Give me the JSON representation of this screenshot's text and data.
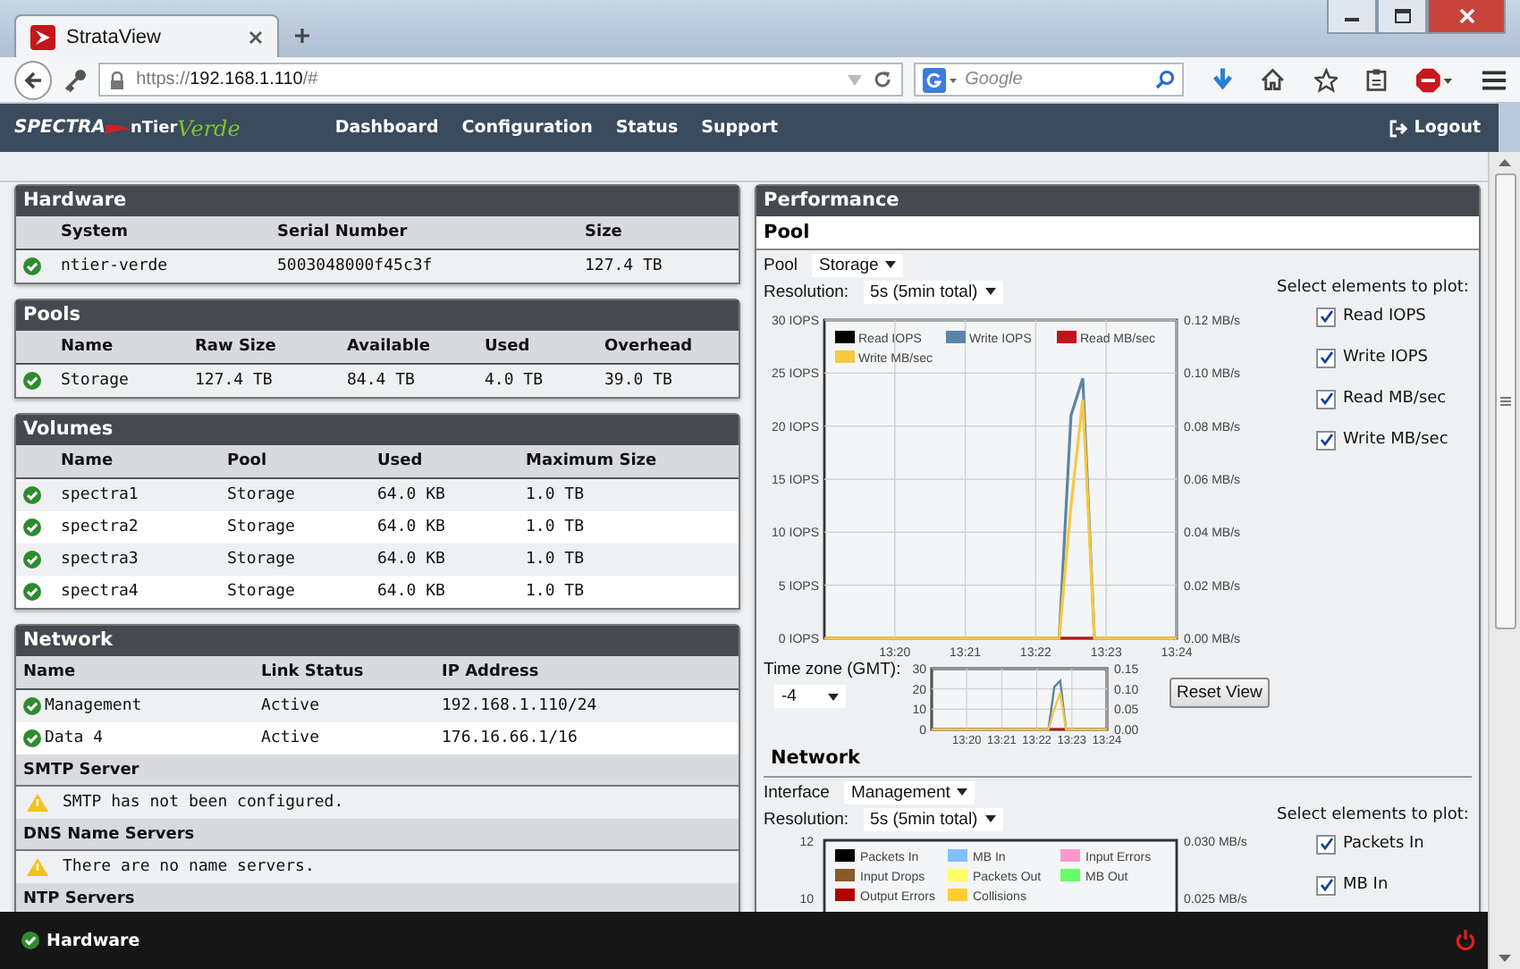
{
  "browser": {
    "tab_title": "StrataView",
    "url": {
      "scheme": "https://",
      "host": "192.168.1.110",
      "path": "/#"
    },
    "search_placeholder": "Google"
  },
  "app_nav": {
    "logo": {
      "brand": "SPECTRA",
      "product": "nTier",
      "product_suffix": "Verde"
    },
    "links": [
      {
        "label": "Dashboard"
      },
      {
        "label": "Configuration"
      },
      {
        "label": "Status"
      },
      {
        "label": "Support"
      }
    ],
    "logout": "Logout"
  },
  "panels": [
    {
      "title": "Hardware",
      "columns": [
        "System",
        "Serial Number",
        "Size"
      ],
      "rows": [
        {
          "kind": "ok",
          "cells": [
            "ntier-verde",
            "5003048000f45c3f",
            "127.4 TB"
          ]
        }
      ]
    },
    {
      "title": "Pools",
      "columns": [
        "Name",
        "Raw Size",
        "Available",
        "Used",
        "Overhead"
      ],
      "rows": [
        {
          "kind": "ok",
          "cells": [
            "Storage",
            "127.4 TB",
            "84.4 TB",
            "4.0 TB",
            "39.0 TB"
          ]
        }
      ]
    },
    {
      "title": "Volumes",
      "columns": [
        "Name",
        "Pool",
        "Used",
        "Maximum Size"
      ],
      "rows": [
        {
          "kind": "ok",
          "cells": [
            "spectra1",
            "Storage",
            "64.0 KB",
            "1.0 TB"
          ]
        },
        {
          "kind": "ok",
          "cells": [
            "spectra2",
            "Storage",
            "64.0 KB",
            "1.0 TB"
          ]
        },
        {
          "kind": "ok",
          "cells": [
            "spectra3",
            "Storage",
            "64.0 KB",
            "1.0 TB"
          ]
        },
        {
          "kind": "ok",
          "cells": [
            "spectra4",
            "Storage",
            "64.0 KB",
            "1.0 TB"
          ]
        }
      ]
    }
  ],
  "network": {
    "title": "Network",
    "columns": [
      "Name",
      "Link Status",
      "IP Address"
    ],
    "rows": [
      {
        "kind": "ok",
        "cells": [
          "Management",
          "Active",
          "192.168.1.110/24"
        ]
      },
      {
        "kind": "ok",
        "cells": [
          "Data 4",
          "Active",
          "176.16.66.1/16"
        ]
      }
    ],
    "sections": [
      {
        "title": "SMTP Server",
        "messages": [
          {
            "kind": "warning",
            "text": "SMTP has not been configured."
          }
        ]
      },
      {
        "title": "DNS Name Servers",
        "messages": [
          {
            "kind": "warning",
            "text": "There are no name servers."
          }
        ]
      },
      {
        "title": "NTP Servers"
      }
    ]
  },
  "performance": {
    "title": "Performance",
    "pool": {
      "title": "Pool",
      "pool_label": "Pool",
      "pool_value": "Storage",
      "resolution_label": "Resolution:",
      "resolution_value": "5s (5min total)",
      "plot_label": "Select elements to plot:",
      "plot_options": [
        {
          "label": "Read IOPS",
          "checked": true
        },
        {
          "label": "Write IOPS",
          "checked": true
        },
        {
          "label": "Read MB/sec",
          "checked": true
        },
        {
          "label": "Write MB/sec",
          "checked": true
        }
      ],
      "chart_data": {
        "type": "line",
        "grid": true,
        "legend": true,
        "categories": [
          null,
          null,
          null,
          null,
          null,
          null,
          "13:20",
          null,
          null,
          null,
          null,
          null,
          "13:21",
          null,
          null,
          null,
          null,
          null,
          "13:22",
          null,
          null,
          null,
          null,
          null,
          "13:23",
          null,
          null,
          null,
          null,
          null,
          "13:24"
        ],
        "ylim": [
          0,
          30
        ],
        "y2lim": [
          0,
          0.12
        ],
        "yticks": [
          {
            "value": 0,
            "label": "0 IOPS"
          },
          {
            "value": 5,
            "label": "5 IOPS"
          },
          {
            "value": 10,
            "label": "10 IOPS"
          },
          {
            "value": 15,
            "label": "15 IOPS"
          },
          {
            "value": 20,
            "label": "20 IOPS"
          },
          {
            "value": 25,
            "label": "25 IOPS"
          },
          {
            "value": 30,
            "label": "30 IOPS"
          }
        ],
        "y2ticks": [
          {
            "value": 0,
            "label": "0.00 MB/s"
          },
          {
            "value": 0.02,
            "label": "0.02 MB/s"
          },
          {
            "value": 0.04,
            "label": "0.04 MB/s"
          },
          {
            "value": 0.06,
            "label": "0.06 MB/s"
          },
          {
            "value": 0.08,
            "label": "0.08 MB/s"
          },
          {
            "value": 0.1,
            "label": "0.10 MB/s"
          },
          {
            "value": 0.12,
            "label": "0.12 MB/s"
          }
        ],
        "series": [
          {
            "name": "Read IOPS",
            "color": "#000000",
            "values": [
              null,
              null,
              null,
              null,
              null,
              null,
              null,
              null,
              null,
              null,
              null,
              null,
              null,
              null,
              null,
              null,
              null,
              null,
              null,
              null,
              null,
              null,
              null,
              null,
              null,
              null,
              null,
              null,
              null,
              null,
              null
            ]
          },
          {
            "name": "Write IOPS",
            "color": "#5b84a8",
            "values": [
              null,
              null,
              null,
              null,
              null,
              null,
              null,
              null,
              null,
              null,
              null,
              null,
              null,
              null,
              null,
              null,
              null,
              null,
              null,
              null,
              0,
              21,
              24.5,
              0,
              null,
              null,
              null,
              null,
              null,
              null,
              null
            ]
          },
          {
            "name": "Read MB/sec",
            "color": "#c0141a",
            "axis": "y2",
            "values": [
              null,
              null,
              null,
              null,
              null,
              null,
              null,
              null,
              null,
              null,
              null,
              null,
              null,
              null,
              null,
              null,
              null,
              null,
              null,
              null,
              0,
              0,
              0,
              0,
              null,
              null,
              null,
              null,
              null,
              null,
              null
            ]
          },
          {
            "name": "Write MB/sec",
            "color": "#f7c842",
            "axis": "y2",
            "values": [
              0,
              0,
              0,
              0,
              0,
              0,
              0,
              0,
              0,
              0,
              0,
              0,
              0,
              0,
              0,
              0,
              0,
              0,
              0,
              0,
              0,
              0.05,
              0.09,
              0,
              0,
              0,
              0,
              0,
              0,
              0,
              0
            ]
          }
        ]
      },
      "timezone_label": "Time zone (GMT):",
      "timezone_value": "-4",
      "overview": {
        "chart_data": {
          "type": "line",
          "grid": true,
          "categories": [
            null,
            null,
            null,
            null,
            null,
            null,
            "13:20",
            null,
            null,
            null,
            null,
            null,
            "13:21",
            null,
            null,
            null,
            null,
            null,
            "13:22",
            null,
            null,
            null,
            null,
            null,
            "13:23",
            null,
            null,
            null,
            null,
            null,
            "13:24"
          ],
          "ylim": [
            0,
            30
          ],
          "y2lim": [
            0,
            0.15
          ],
          "yticks": [
            0,
            10,
            20,
            30
          ],
          "y2ticks": [
            {
              "value": 0,
              "label": "0.00"
            },
            {
              "value": 0.05,
              "label": "0.05"
            },
            {
              "value": 0.1,
              "label": "0.10"
            },
            {
              "value": 0.15,
              "label": "0.15"
            }
          ],
          "series": [
            {
              "color": "#5b84a8",
              "values": [
                null,
                null,
                null,
                null,
                null,
                null,
                null,
                null,
                null,
                null,
                null,
                null,
                null,
                null,
                null,
                null,
                null,
                null,
                null,
                null,
                0,
                21,
                24,
                0,
                null,
                null,
                null,
                null,
                null,
                null,
                null
              ]
            },
            {
              "color": "#c0141a",
              "axis": "y2",
              "values": [
                null,
                null,
                null,
                null,
                null,
                null,
                null,
                null,
                null,
                null,
                null,
                null,
                null,
                null,
                null,
                null,
                null,
                null,
                null,
                null,
                0,
                0,
                0,
                0,
                null,
                null,
                null,
                null,
                null,
                null,
                null
              ]
            },
            {
              "color": "#f7c842",
              "axis": "y2",
              "values": [
                0,
                0,
                0,
                0,
                0,
                0,
                0,
                0,
                0,
                0,
                0,
                0,
                0,
                0,
                0,
                0,
                0,
                0,
                0,
                0,
                0,
                0.05,
                0.09,
                0,
                0,
                0,
                0,
                0,
                0,
                0,
                0
              ]
            }
          ]
        }
      },
      "reset_button": "Reset View"
    },
    "network": {
      "title": "Network",
      "interface_label": "Interface",
      "interface_value": "Management",
      "resolution_label": "Resolution:",
      "resolution_value": "5s (5min total)",
      "plot_label": "Select elements to plot:",
      "plot_options": [
        {
          "label": "Packets In",
          "checked": true
        },
        {
          "label": "MB In",
          "checked": true
        }
      ],
      "chart": {
        "left_ticks": [
          "12",
          "10"
        ],
        "right_ticks": [
          "0.030 MB/s",
          "0.025 MB/s"
        ],
        "legend": [
          {
            "label": "Packets In",
            "color": "#000000"
          },
          {
            "label": "MB In",
            "color": "#7fbfff"
          },
          {
            "label": "Input Errors",
            "color": "#ff99cc"
          },
          {
            "label": "Input Drops",
            "color": "#8b5a2b"
          },
          {
            "label": "Packets Out",
            "color": "#ffff66"
          },
          {
            "label": "MB Out",
            "color": "#66ff66"
          },
          {
            "label": "Output Errors",
            "color": "#b00000"
          },
          {
            "label": "Collisions",
            "color": "#ffcc33"
          }
        ]
      }
    }
  },
  "bottom_bar": {
    "kind": "ok",
    "label": "Hardware"
  }
}
